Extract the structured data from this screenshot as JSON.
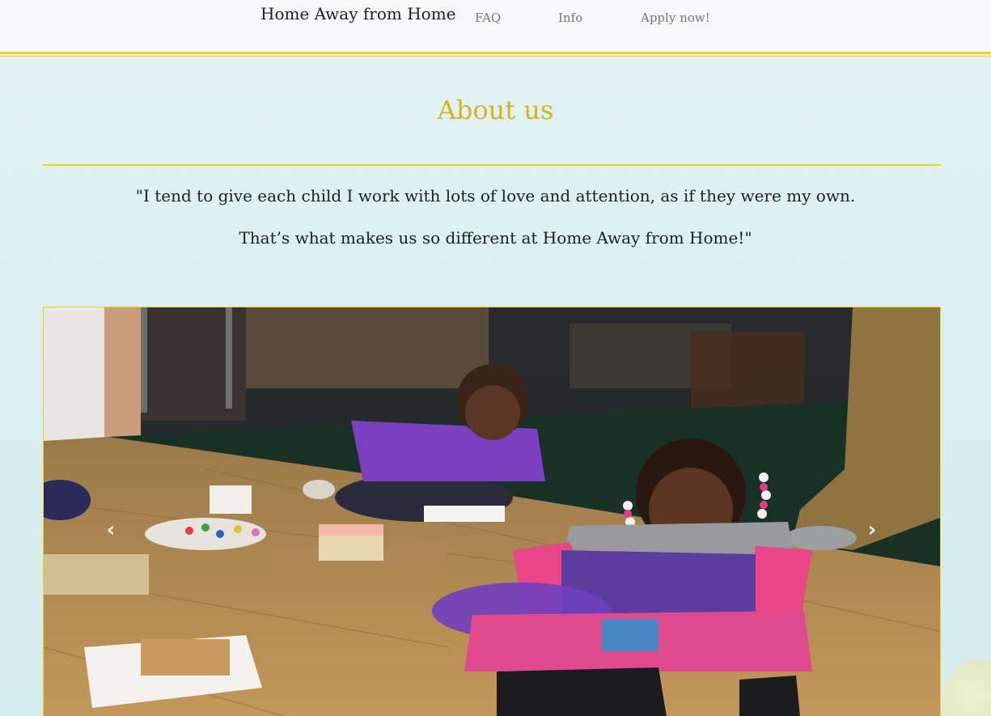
{
  "navbar": {
    "brand": "Home Away from Home",
    "links": [
      "FAQ",
      "Info",
      "Apply now!"
    ]
  },
  "main": {
    "heading": "About us",
    "quote_lines": [
      "\"I tend to give each child I work with lots of love and attention, as if they were my own.",
      "That’s what makes us so different at Home Away from Home!\""
    ]
  },
  "carousel": {
    "prev_icon": "chevron-left-icon",
    "next_icon": "chevron-right-icon",
    "prev_glyph": "‹",
    "next_glyph": "›"
  },
  "colors": {
    "accent": "#f0d21b",
    "heading": "#d4b41c",
    "nav_bg": "#f7f8fa",
    "page_bg": "#dcefef"
  }
}
